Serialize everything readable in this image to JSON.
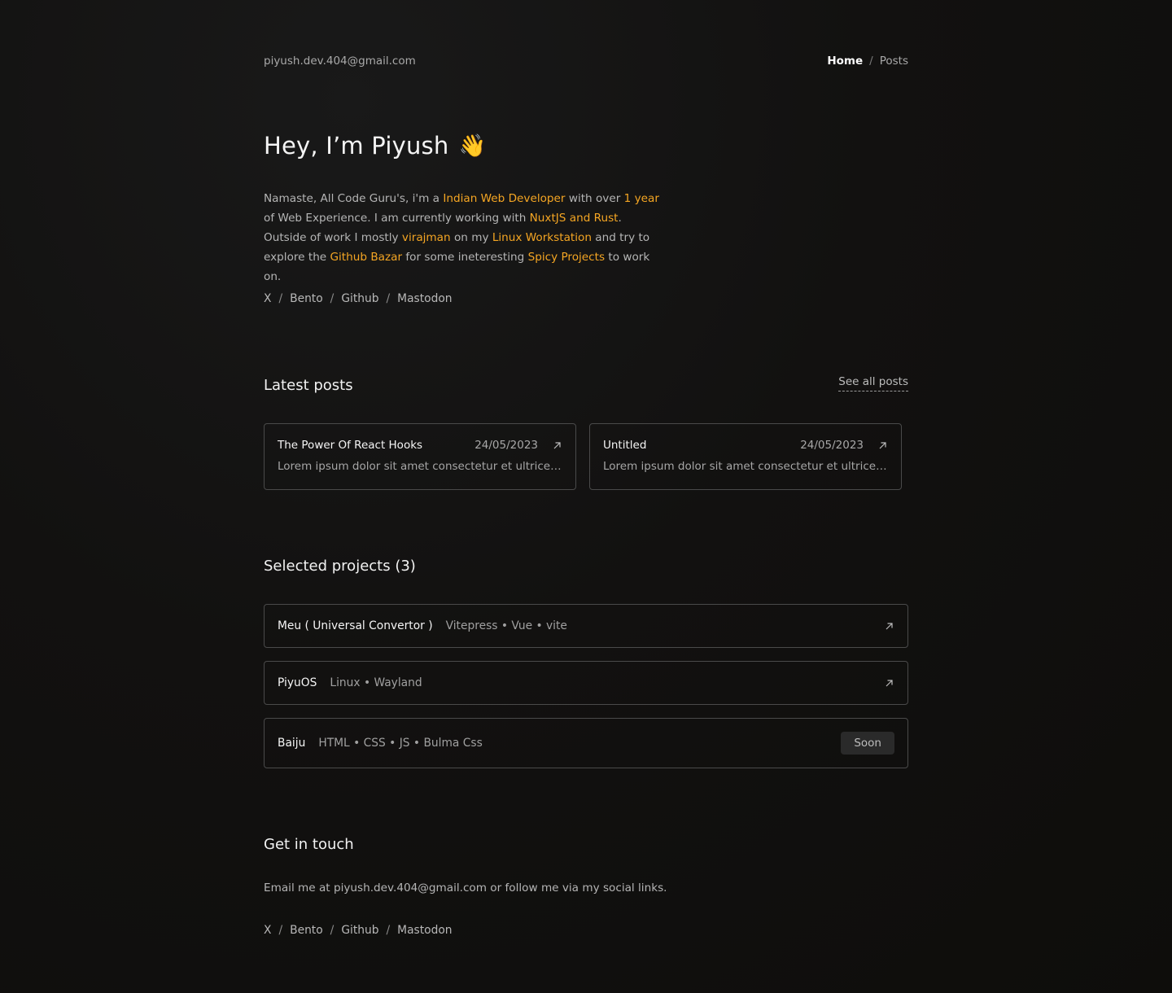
{
  "header": {
    "email": "piyush.dev.404@gmail.com",
    "nav": {
      "home": "Home",
      "separator": "/",
      "posts": "Posts"
    }
  },
  "hero": {
    "title": "Hey, I’m Piyush",
    "emoji": "👋",
    "intro": [
      {
        "t": "Namaste, All Code Guru's, i'm a ",
        "hl": false
      },
      {
        "t": "Indian Web Developer",
        "hl": true
      },
      {
        "t": " with over ",
        "hl": false
      },
      {
        "t": "1 year",
        "hl": true
      },
      {
        "t": " of Web Experience. I am currently working with ",
        "hl": false
      },
      {
        "t": "NuxtJS and Rust",
        "hl": true
      },
      {
        "t": ". Outside of work I mostly ",
        "hl": false
      },
      {
        "t": "virajman",
        "hl": true
      },
      {
        "t": " on my ",
        "hl": false
      },
      {
        "t": "Linux Workstation",
        "hl": true
      },
      {
        "t": " and try to explore the ",
        "hl": false
      },
      {
        "t": "Github Bazar",
        "hl": true
      },
      {
        "t": " for some ineteresting ",
        "hl": false
      },
      {
        "t": "Spicy Projects",
        "hl": true
      },
      {
        "t": " to work on.",
        "hl": false
      }
    ]
  },
  "socials": {
    "x": "X",
    "bento": "Bento",
    "github": "Github",
    "mastodon": "Mastodon",
    "separator": "/"
  },
  "latest": {
    "title": "Latest posts",
    "see_all": "See all posts",
    "posts": [
      {
        "title": "The Power Of React Hooks",
        "date": "24/05/2023",
        "excerpt": "Lorem ipsum dolor sit amet consectetur et ultrices ..."
      },
      {
        "title": "Untitled",
        "date": "24/05/2023",
        "excerpt": "Lorem ipsum dolor sit amet consectetur et ultrices ..."
      }
    ]
  },
  "projects": {
    "title": "Selected projects (3)",
    "items": [
      {
        "name": "Meu ( Universal Convertor )",
        "tags": "Vitepress • Vue • vite"
      },
      {
        "name": "PiyuOS",
        "tags": "Linux • Wayland"
      },
      {
        "name": "Baiju",
        "tags": "HTML • CSS • JS • Bulma Css",
        "badge": "Soon"
      }
    ]
  },
  "contact": {
    "title": "Get in touch",
    "text": "Email me at piyush.dev.404@gmail.com or follow me via my social links."
  },
  "colors": {
    "accent": "#f5a623",
    "background": "#121110",
    "border": "#4a4a4a"
  },
  "icons": {
    "post_link": "arrow-up-right-icon",
    "project_link": "arrow-up-right-icon"
  }
}
